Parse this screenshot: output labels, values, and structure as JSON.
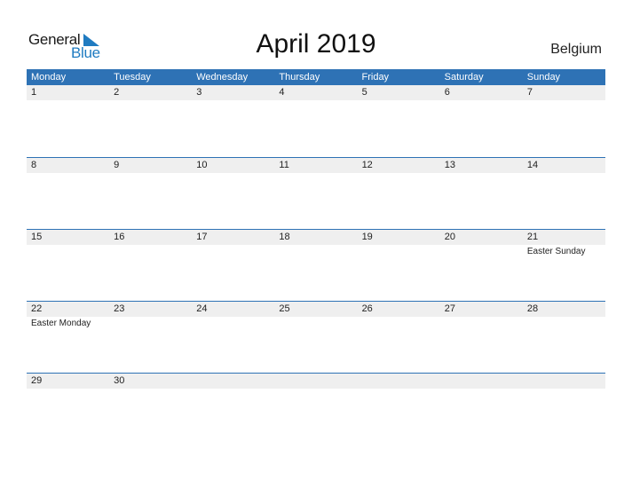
{
  "logo": {
    "part1": "General",
    "part2": "Blue",
    "icon": "triangle-flag-icon"
  },
  "title": "April 2019",
  "country": "Belgium",
  "colors": {
    "header_bg": "#2e72b5",
    "date_strip": "#efefef",
    "logo_blue": "#1f7bc1"
  },
  "weekdays": [
    "Monday",
    "Tuesday",
    "Wednesday",
    "Thursday",
    "Friday",
    "Saturday",
    "Sunday"
  ],
  "weeks": [
    [
      {
        "day": "1",
        "holiday": ""
      },
      {
        "day": "2",
        "holiday": ""
      },
      {
        "day": "3",
        "holiday": ""
      },
      {
        "day": "4",
        "holiday": ""
      },
      {
        "day": "5",
        "holiday": ""
      },
      {
        "day": "6",
        "holiday": ""
      },
      {
        "day": "7",
        "holiday": ""
      }
    ],
    [
      {
        "day": "8",
        "holiday": ""
      },
      {
        "day": "9",
        "holiday": ""
      },
      {
        "day": "10",
        "holiday": ""
      },
      {
        "day": "11",
        "holiday": ""
      },
      {
        "day": "12",
        "holiday": ""
      },
      {
        "day": "13",
        "holiday": ""
      },
      {
        "day": "14",
        "holiday": ""
      }
    ],
    [
      {
        "day": "15",
        "holiday": ""
      },
      {
        "day": "16",
        "holiday": ""
      },
      {
        "day": "17",
        "holiday": ""
      },
      {
        "day": "18",
        "holiday": ""
      },
      {
        "day": "19",
        "holiday": ""
      },
      {
        "day": "20",
        "holiday": ""
      },
      {
        "day": "21",
        "holiday": "Easter Sunday"
      }
    ],
    [
      {
        "day": "22",
        "holiday": "Easter Monday"
      },
      {
        "day": "23",
        "holiday": ""
      },
      {
        "day": "24",
        "holiday": ""
      },
      {
        "day": "25",
        "holiday": ""
      },
      {
        "day": "26",
        "holiday": ""
      },
      {
        "day": "27",
        "holiday": ""
      },
      {
        "day": "28",
        "holiday": ""
      }
    ],
    [
      {
        "day": "29",
        "holiday": ""
      },
      {
        "day": "30",
        "holiday": ""
      },
      {
        "day": "",
        "holiday": ""
      },
      {
        "day": "",
        "holiday": ""
      },
      {
        "day": "",
        "holiday": ""
      },
      {
        "day": "",
        "holiday": ""
      },
      {
        "day": "",
        "holiday": ""
      }
    ]
  ]
}
